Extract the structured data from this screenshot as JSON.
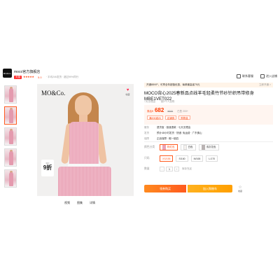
{
  "store": {
    "logo_text": "MO&Co.",
    "name": "moco官方旗舰店",
    "tag": "天猫",
    "stars": "★★★★★",
    "score": "5.0",
    "meta": "· 平均24h发货 · 超过99%同行"
  },
  "top_actions": [
    {
      "label": "联系客服",
      "icon": "chat-icon"
    },
    {
      "label": "进入店铺",
      "icon": "store-icon"
    }
  ],
  "main_image": {
    "brand": "MO&Co.",
    "fav_label": "收藏",
    "discount_small": "限时",
    "discount_big": "9折"
  },
  "image_tabs": [
    "视频",
    "图集",
    "详情"
  ],
  "notice": {
    "text": "开通88VIP，可享全年超值优惠，每单最高省75元",
    "highlight": "88VIP",
    "link": "立即开通 >"
  },
  "product": {
    "title": "MOCO背心2025春新品点线羊毛轻柔竹节纱针织吊带修身MBE1VET022",
    "sub": [
      "7天无理由",
      "超2千人加购"
    ],
    "price_label": "券后¥",
    "price": "682",
    "price_orig": "¥699",
    "sold": "已售 200+",
    "coupons": [
      "满200减20",
      "店铺券",
      "购物金"
    ]
  },
  "shipping": [
    {
      "label": "服务",
      "value": "退货宝 · 极速退款 · 七天无理由"
    },
    {
      "label": "发货",
      "value": "预计48小时发货 · 快递: 免运费 · 广东佛山"
    },
    {
      "label": "保障",
      "value": "正品保障 · 假一赔四"
    }
  ],
  "options": {
    "color_label": "颜色分类",
    "colors": [
      {
        "label": "粉红色",
        "swatch": "pink",
        "selected": true
      },
      {
        "label": "白色",
        "swatch": "white",
        "selected": false
      },
      {
        "label": "浅灰花色",
        "swatch": "gray",
        "selected": false
      }
    ],
    "size_label": "尺码",
    "sizes": [
      {
        "label": "XS/155",
        "selected": true
      },
      {
        "label": "S/160",
        "selected": false
      },
      {
        "label": "M/165",
        "selected": false
      },
      {
        "label": "L/170",
        "selected": false
      }
    ],
    "qty_label": "数量",
    "qty": "1",
    "qty_note": "库存充足",
    "minus": "-",
    "plus": "+"
  },
  "actions": {
    "buy": "领券购买",
    "cart": "加入购物车",
    "collect": "收藏"
  },
  "colors": {
    "accent": "#ff5a1f",
    "price": "#ff3b00"
  }
}
